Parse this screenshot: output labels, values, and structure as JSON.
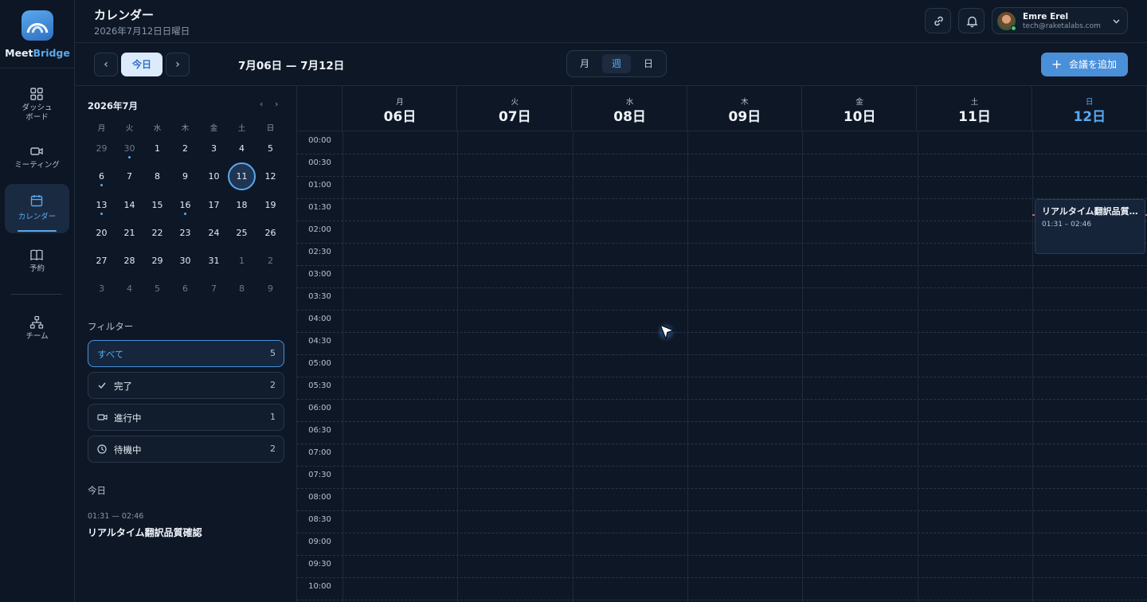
{
  "app": {
    "brand_part1": "Meet",
    "brand_part2": "Bridge"
  },
  "nav": {
    "dashboard": "ダッシュ\nボード",
    "meeting": "ミーティング",
    "calendar": "カレンダー",
    "booking": "予約",
    "team": "チーム"
  },
  "header": {
    "title": "カレンダー",
    "subtitle": "2026年7月12日日曜日",
    "user_name": "Emre Erel",
    "user_email": "tech@raketalabs.com"
  },
  "toolbar": {
    "prev": "‹",
    "today": "今日",
    "next": "›",
    "range": "7月06日 — 7月12日",
    "views": [
      "月",
      "週",
      "日"
    ],
    "active_view": "週",
    "add_button": "会議を追加"
  },
  "mini_calendar": {
    "title": "2026年7月",
    "nav_prev": "‹",
    "nav_next": "›",
    "weekdays": [
      "月",
      "火",
      "水",
      "木",
      "金",
      "土",
      "日"
    ],
    "weeks": [
      [
        "29",
        "30",
        "1",
        "2",
        "3",
        "4",
        "5"
      ],
      [
        "6",
        "7",
        "8",
        "9",
        "10",
        "11",
        "12"
      ],
      [
        "13",
        "14",
        "15",
        "16",
        "17",
        "18",
        "19"
      ],
      [
        "20",
        "21",
        "22",
        "23",
        "24",
        "25",
        "26"
      ],
      [
        "27",
        "28",
        "29",
        "30",
        "31",
        "1",
        "2"
      ],
      [
        "3",
        "4",
        "5",
        "6",
        "7",
        "8",
        "9"
      ]
    ],
    "selected": "11"
  },
  "filters": {
    "label": "フィルター",
    "items": [
      {
        "label": "すべて",
        "count": "5"
      },
      {
        "label": "完了",
        "count": "2"
      },
      {
        "label": "進行中",
        "count": "1"
      },
      {
        "label": "待機中",
        "count": "2"
      }
    ]
  },
  "today_panel": {
    "label": "今日",
    "event_time": "01:31 — 02:46",
    "event_title": "リアルタイム翻訳品質確認"
  },
  "week": {
    "days": [
      {
        "weekday": "月",
        "day": "06日"
      },
      {
        "weekday": "火",
        "day": "07日"
      },
      {
        "weekday": "水",
        "day": "08日"
      },
      {
        "weekday": "木",
        "day": "09日"
      },
      {
        "weekday": "金",
        "day": "10日"
      },
      {
        "weekday": "土",
        "day": "11日"
      },
      {
        "weekday": "日",
        "day": "12日"
      }
    ],
    "times": [
      "00:00",
      "00:30",
      "01:00",
      "01:30",
      "02:00",
      "02:30",
      "03:00",
      "03:30",
      "04:00",
      "04:30",
      "05:00",
      "05:30",
      "06:00",
      "06:30",
      "07:00",
      "07:30",
      "08:00",
      "08:30",
      "09:00",
      "09:30",
      "10:00"
    ],
    "event": {
      "title": "リアルタイム翻訳品質確認",
      "time": "01:31 – 02:46"
    }
  },
  "colors": {
    "accent": "#5aa9ef",
    "primary_button": "#4a90d9",
    "now_line": "#e05a6a",
    "background": "#0e1726"
  }
}
